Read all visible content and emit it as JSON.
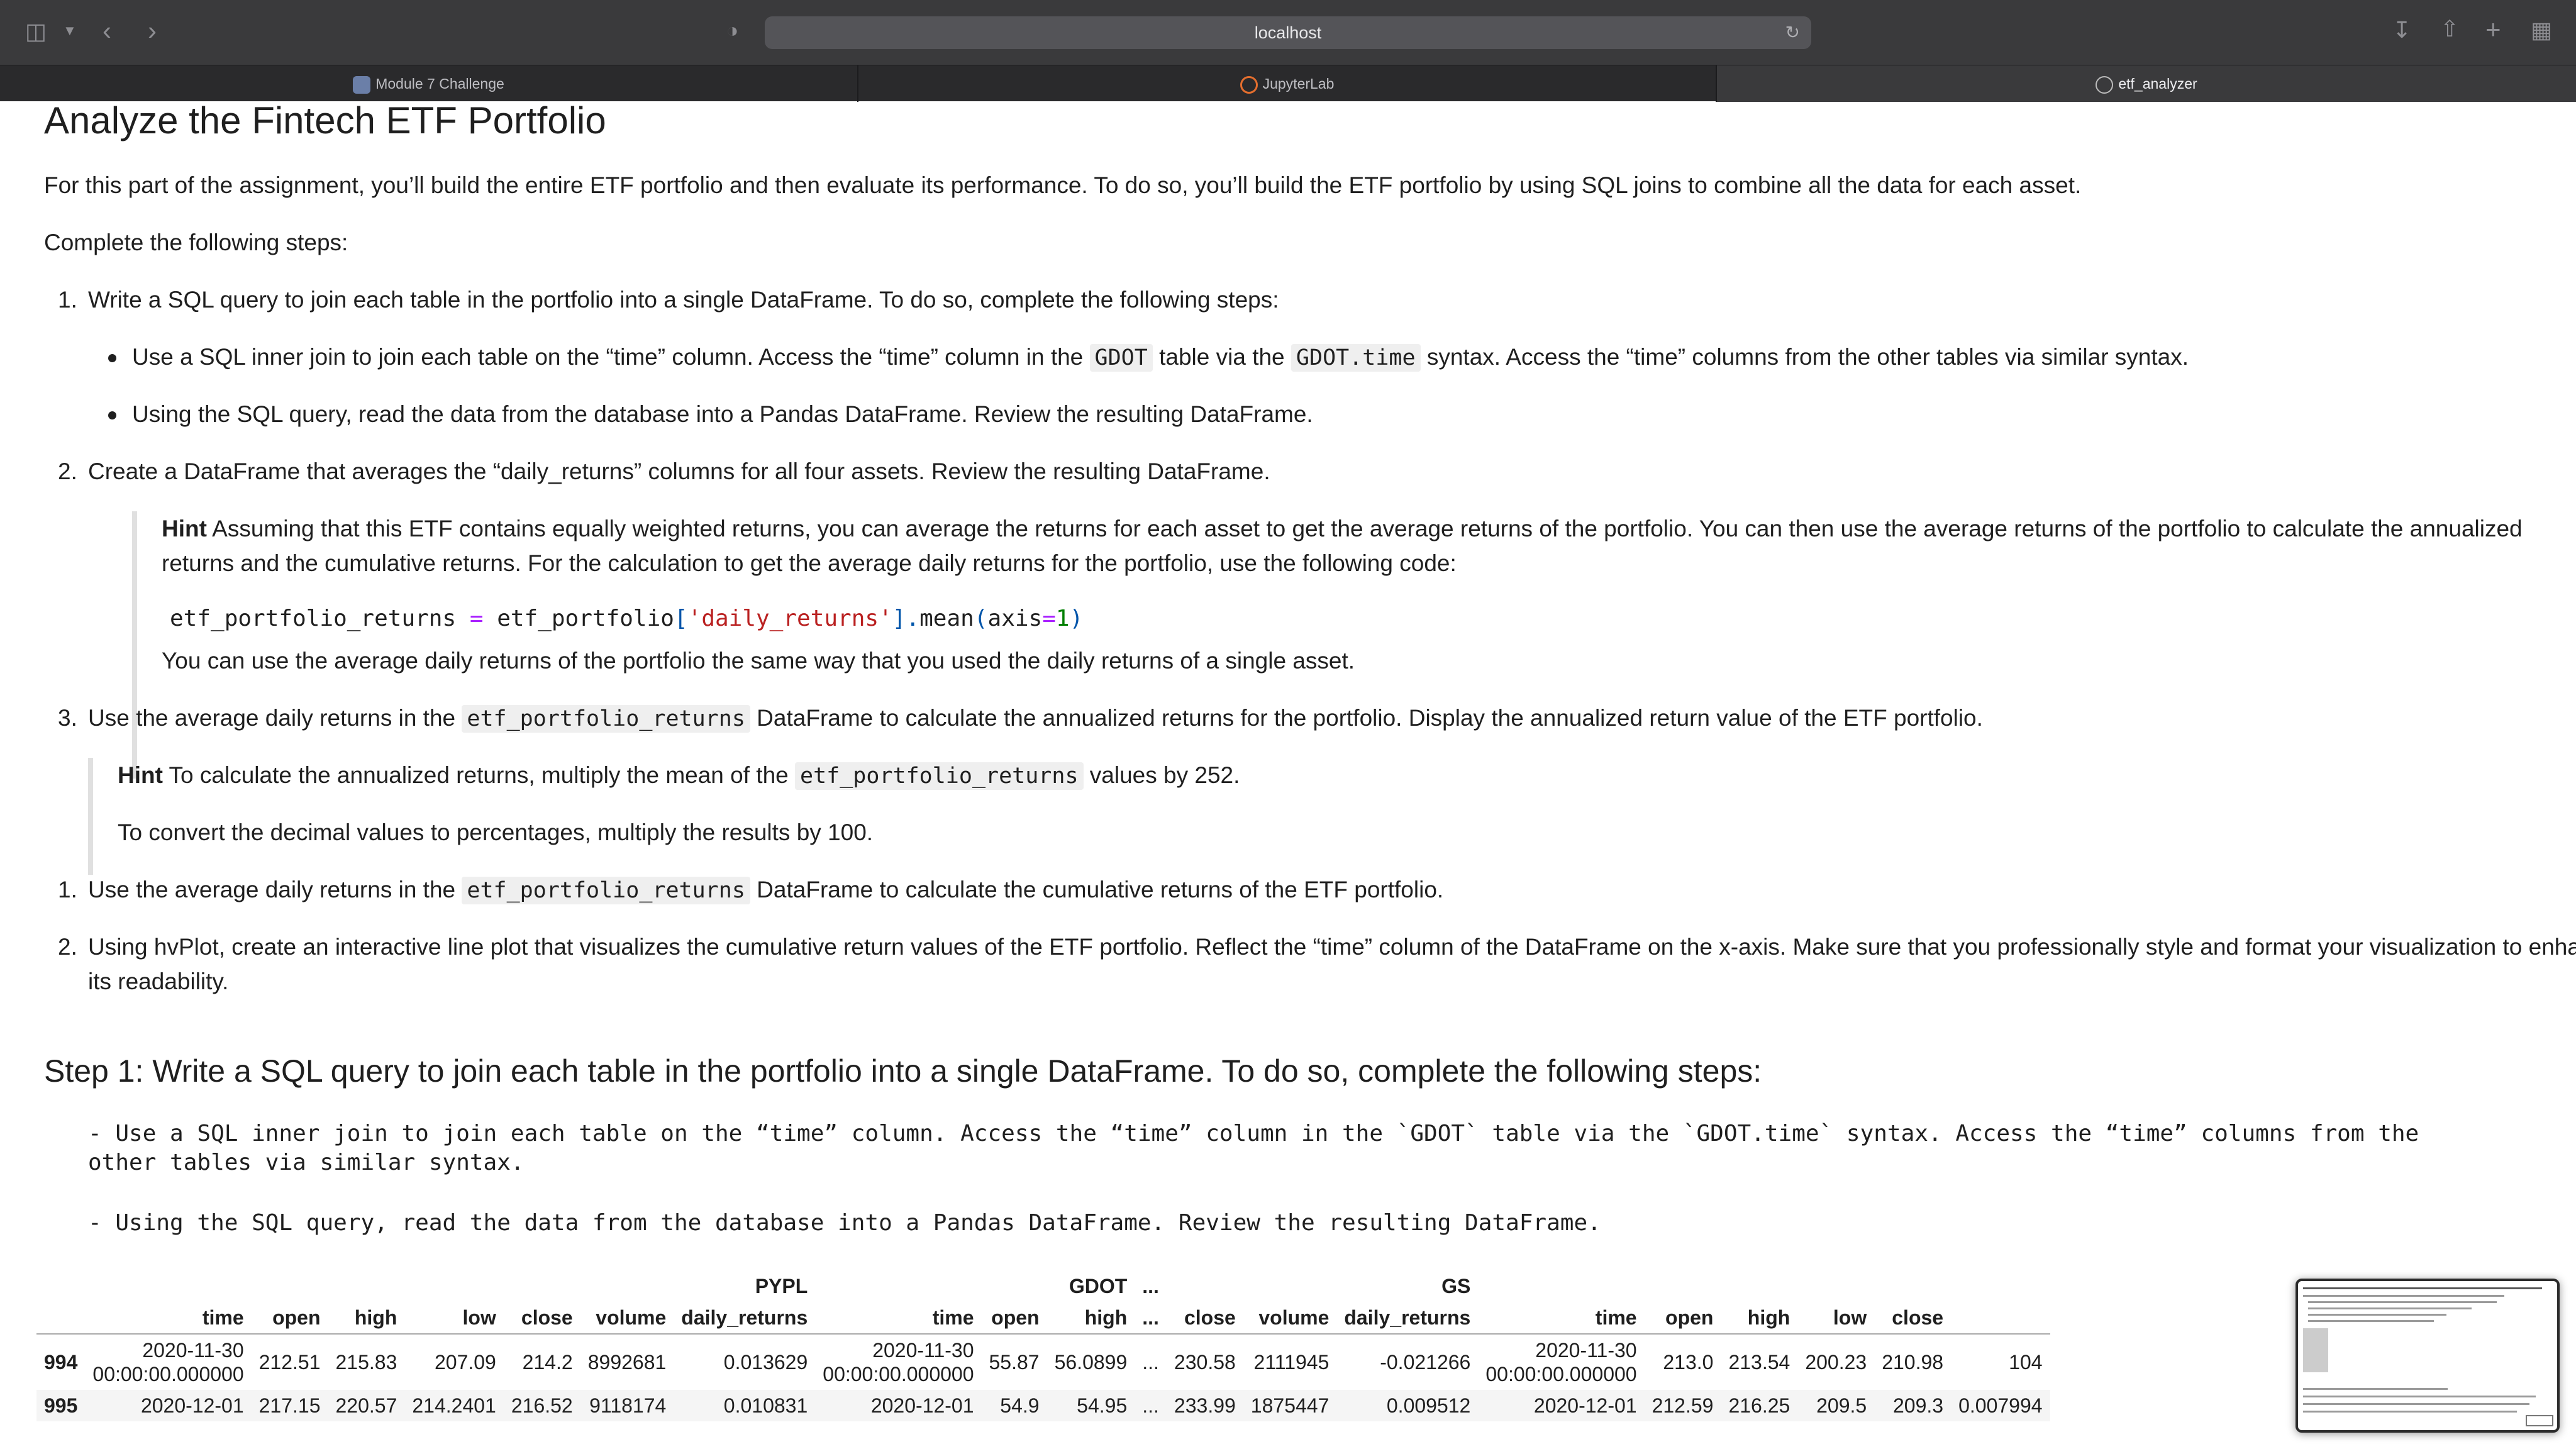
{
  "browser": {
    "url": "localhost",
    "tabs": [
      {
        "label": "Module 7 Challenge"
      },
      {
        "label": "JupyterLab"
      },
      {
        "label": "etf_analyzer"
      }
    ]
  },
  "doc": {
    "title": "Analyze the Fintech ETF Portfolio",
    "intro": "For this part of the assignment, you’ll build the entire ETF portfolio and then evaluate its performance. To do so, you’ll build the ETF portfolio by using SQL joins to combine all the data for each asset.",
    "complete": "Complete the following steps:",
    "s1_num": "1.",
    "s1": "Write a SQL query to join each table in the portfolio into a single DataFrame. To do so, complete the following steps:",
    "b1_a": "Use a SQL inner join to join each table on the “time” column. Access the “time” column in the ",
    "b1_code1": "GDOT",
    "b1_b": " table via the ",
    "b1_code2": "GDOT.time",
    "b1_c": " syntax. Access the “time” columns from the other tables via similar syntax.",
    "b2": "Using the SQL query, read the data from the database into a Pandas DataFrame. Review the resulting DataFrame.",
    "s2_num": "2.",
    "s2": "Create a DataFrame that averages the “daily_returns” columns for all four assets. Review the resulting DataFrame.",
    "hint_label": "Hint",
    "hint1_l1": " Assuming that this ETF contains equally weighted returns, you can average the returns for each asset to get the average returns of the portfolio. You can then use the average returns of the portfolio to calculate the annualized",
    "hint1_l2": "returns and the cumulative returns. For the calculation to get the average daily returns for the portfolio, use the following code:",
    "code_a": "etf_portfolio_returns ",
    "code_eq": "=",
    "code_b": " etf_portfolio",
    "code_br1": "[",
    "code_str": "'daily_returns'",
    "code_br2": "]",
    "code_dot": ".",
    "code_c": "mean",
    "code_p1": "(",
    "code_d": "axis",
    "code_eq2": "=",
    "code_num": "1",
    "code_p2": ")",
    "hint1_after": "You can use the average daily returns of the portfolio the same way that you used the daily returns of a single asset.",
    "s3_num": "3.",
    "s3_a": "Use the average daily returns in the ",
    "s3_code": "etf_portfolio_returns",
    "s3_b": " DataFrame to calculate the annualized returns for the portfolio. Display the annualized return value of the ETF portfolio.",
    "hint2_a": " To calculate the annualized returns, multiply the mean of the ",
    "hint2_code": "etf_portfolio_returns",
    "hint2_b": " values by 252.",
    "hint2_l2": "To convert the decimal values to percentages, multiply the results by 100.",
    "s4_num": "1.",
    "s4_a": "Use the average daily returns in the ",
    "s4_code": "etf_portfolio_returns",
    "s4_b": " DataFrame to calculate the cumulative returns of the ETF portfolio.",
    "s5_num": "2.",
    "s5_l1": "Using hvPlot, create an interactive line plot that visualizes the cumulative return values of the ETF portfolio. Reflect the “time” column of the DataFrame on the x-axis. Make sure that you professionally style and format your visualization to enhance",
    "s5_l2": "its readability.",
    "step1_heading": "Step 1: Write a SQL query to join each table in the portfolio into a single DataFrame. To do so, complete the following steps:",
    "mono1_l1": "- Use a SQL inner join to join each table on the “time” column. Access the “time” column in the `GDOT` table via the `GDOT.time` syntax. Access the “time” columns from the",
    "mono1_l2": "other tables via similar syntax.",
    "mono2": "- Using the SQL query, read the data from the database into a Pandas DataFrame. Review the resulting DataFrame."
  },
  "table": {
    "groups": {
      "pypl": "PYPL",
      "gdot": "GDOT",
      "ellipsis": "...",
      "gs": "GS"
    },
    "columns": [
      "time",
      "open",
      "high",
      "low",
      "close",
      "volume",
      "daily_returns",
      "time",
      "open",
      "high",
      "...",
      "close",
      "volume",
      "daily_returns",
      "time",
      "open",
      "high",
      "low",
      "close"
    ],
    "rows": [
      {
        "index": "994",
        "cells": [
          "2020-11-30",
          "212.51",
          "215.83",
          "207.09",
          "214.2",
          "8992681",
          "0.013629",
          "2020-11-30",
          "55.87",
          "56.0899",
          "...",
          "230.58",
          "2111945",
          "-0.021266",
          "2020-11-30",
          "213.0",
          "213.54",
          "200.23",
          "210.98"
        ],
        "time_suffix": "00:00:00.000000",
        "cut": "104"
      },
      {
        "index": "995",
        "cells": [
          "2020-12-01",
          "217.15",
          "220.57",
          "214.2401",
          "216.52",
          "9118174",
          "0.010831",
          "2020-12-01",
          "54.9",
          "54.95",
          "...",
          "233.99",
          "1875447",
          "0.009512",
          "2020-12-01",
          "212.59",
          "216.25",
          "209.5",
          "209.3"
        ],
        "cut_tail": "0.007994"
      }
    ]
  }
}
